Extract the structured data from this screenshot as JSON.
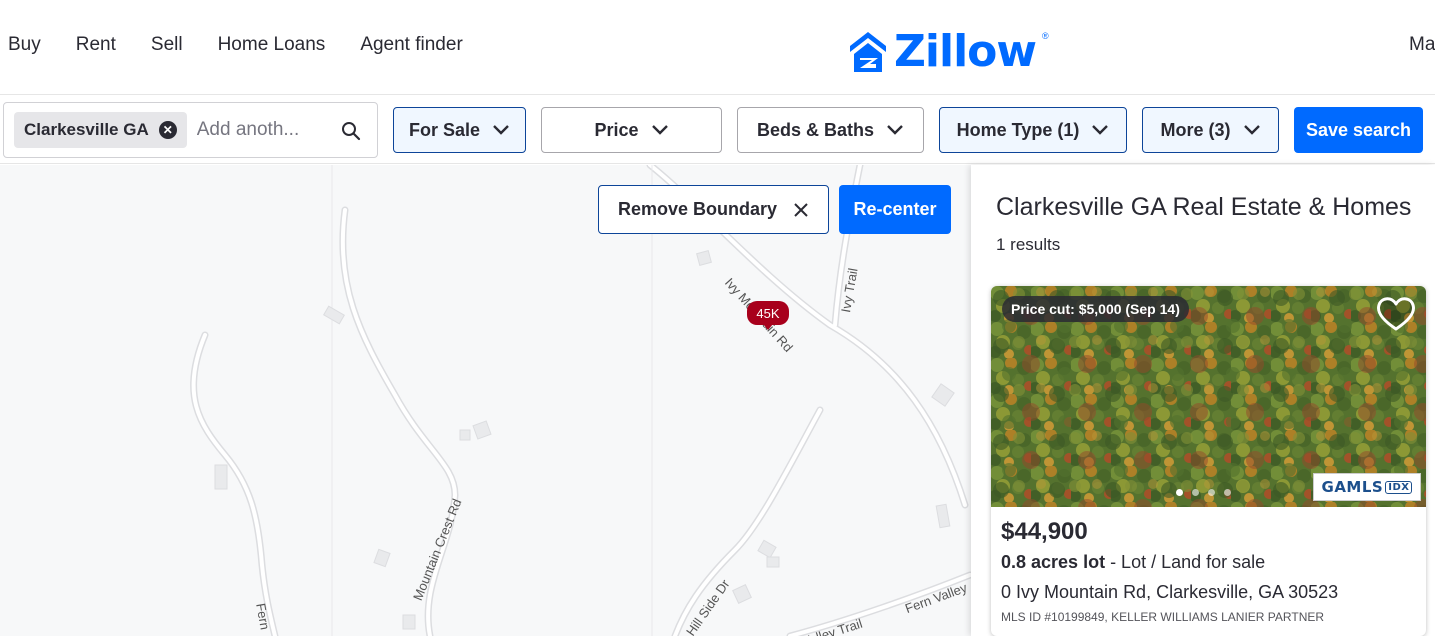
{
  "nav": {
    "links": [
      "Buy",
      "Rent",
      "Sell",
      "Home Loans",
      "Agent finder"
    ],
    "logo_text": "Zillow",
    "logo_mark": "®",
    "right_partial": "Ma"
  },
  "search": {
    "chip_label": "Clarkesville GA",
    "placeholder": "Add anoth...",
    "icon": "search-icon"
  },
  "filters": {
    "for_sale": "For Sale",
    "price": "Price",
    "beds_baths": "Beds & Baths",
    "home_type": "Home Type (1)",
    "more": "More (3)",
    "save_search": "Save search"
  },
  "map": {
    "remove_boundary": "Remove Boundary",
    "recenter": "Re-center",
    "pin_label": "45K",
    "roads": {
      "ivy_mountain": "Ivy Mountain Rd",
      "ivy_trail": "Ivy Trail",
      "mountain_crest": "Mountain Crest Rd",
      "hill_side": "Hill Side Dr",
      "fern_valley": "Fern Valley",
      "valley_trail": "Valley Trail",
      "fern": "Fern"
    }
  },
  "results": {
    "title": "Clarkesville GA Real Estate & Homes",
    "count": "1 results"
  },
  "listing": {
    "badge": "Price cut: $5,000 (Sep 14)",
    "price": "$44,900",
    "size": "0.8 acres lot",
    "type": " - Lot / Land for sale",
    "address": "0 Ivy Mountain Rd, Clarkesville, GA 30523",
    "mls": "MLS ID #10199849, KELLER WILLIAMS LANIER PARTNER",
    "mls_logo": "GAMLS",
    "mls_logo_suffix": "IDX",
    "photo_count": 4,
    "photo_index": 1
  },
  "colors": {
    "brand": "#006aff",
    "pin": "#a8001c",
    "active_border": "#0d4599"
  }
}
